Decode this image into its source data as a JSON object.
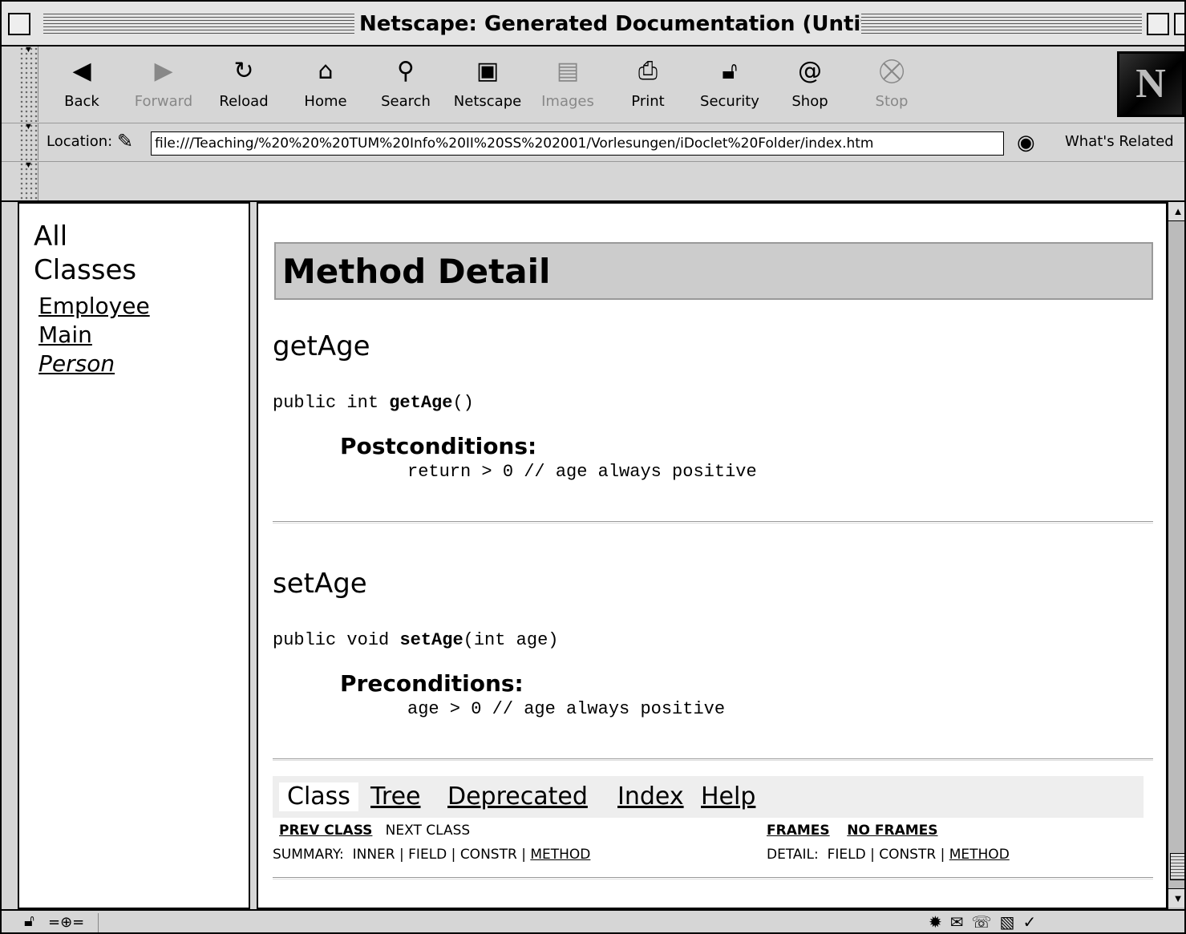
{
  "window": {
    "title": "Netscape: Generated Documentation (Untitled)"
  },
  "toolbar": {
    "buttons": [
      {
        "label": "Back",
        "icon": "back-arrow-icon",
        "enabled": true
      },
      {
        "label": "Forward",
        "icon": "forward-arrow-icon",
        "enabled": false
      },
      {
        "label": "Reload",
        "icon": "reload-icon",
        "enabled": true
      },
      {
        "label": "Home",
        "icon": "home-icon",
        "enabled": true
      },
      {
        "label": "Search",
        "icon": "search-icon",
        "enabled": true
      },
      {
        "label": "Netscape",
        "icon": "my-netscape-icon",
        "enabled": true
      },
      {
        "label": "Images",
        "icon": "images-icon",
        "enabled": false
      },
      {
        "label": "Print",
        "icon": "print-icon",
        "enabled": true
      },
      {
        "label": "Security",
        "icon": "security-lock-icon",
        "enabled": true
      },
      {
        "label": "Shop",
        "icon": "shop-bag-icon",
        "enabled": true
      },
      {
        "label": "Stop",
        "icon": "stop-icon",
        "enabled": false
      }
    ],
    "logo_letter": "N"
  },
  "location": {
    "label": "Location:",
    "url": "file:///Teaching/%20%20%20TUM%20Info%20II%20SS%202001/Vorlesungen/iDoclet%20Folder/index.htm",
    "related": "What's Related"
  },
  "left_frame": {
    "heading_line1": "All",
    "heading_line2": "Classes",
    "classes": [
      "Employee",
      "Main",
      "Person"
    ]
  },
  "content": {
    "section_title": "Method Detail",
    "methods": [
      {
        "name": "getAge",
        "sig_prefix": "public int ",
        "sig_name": "getAge",
        "sig_suffix": "()",
        "cond_heading": "Postconditions:",
        "cond_text": "return > 0 // age always positive"
      },
      {
        "name": "setAge",
        "sig_prefix": "public void ",
        "sig_name": "setAge",
        "sig_suffix": "(int age)",
        "cond_heading": "Preconditions:",
        "cond_text": "age > 0 // age always positive"
      }
    ],
    "navbar": {
      "items": [
        "Class",
        "Tree",
        "Deprecated",
        "Index",
        "Help"
      ]
    },
    "subnav": {
      "prev_class": "PREV CLASS",
      "next_class": "NEXT CLASS",
      "frames": "FRAMES",
      "no_frames": "NO FRAMES",
      "summary_label": "SUMMARY:",
      "summary_inner": "INNER",
      "summary_field": "FIELD",
      "summary_constr": "CONSTR",
      "summary_method": "METHOD",
      "detail_label": "DETAIL:",
      "detail_field": "FIELD",
      "detail_constr": "CONSTR",
      "detail_method": "METHOD",
      "sep": "|"
    }
  }
}
